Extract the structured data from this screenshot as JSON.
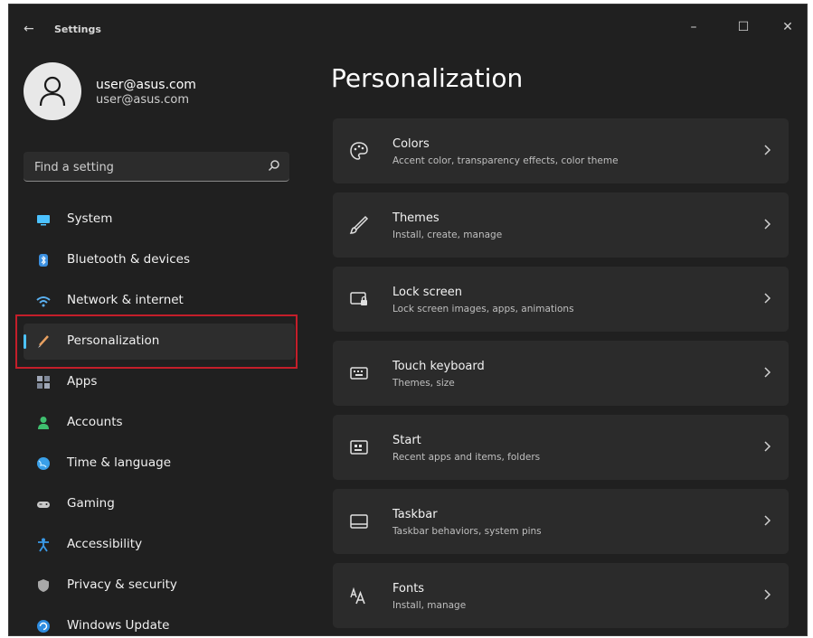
{
  "window": {
    "title": "Settings",
    "back_glyph": "←",
    "controls": {
      "minimize": "–",
      "maximize": "☐",
      "close": "✕"
    }
  },
  "profile": {
    "name": "user@asus.com",
    "email": "user@asus.com",
    "avatar_icon": "person-icon"
  },
  "search": {
    "placeholder": "Find a setting",
    "icon": "search-icon"
  },
  "sidebar": {
    "items": [
      {
        "label": "System",
        "icon": "monitor-icon",
        "color": "#4cc2ff"
      },
      {
        "label": "Bluetooth & devices",
        "icon": "bluetooth-icon",
        "color": "#3a8fe0"
      },
      {
        "label": "Network & internet",
        "icon": "wifi-icon",
        "color": "#5ab0f0"
      },
      {
        "label": "Personalization",
        "icon": "brush-icon",
        "color": "#e8a060",
        "active": true
      },
      {
        "label": "Apps",
        "icon": "apps-icon",
        "color": "#a0a8b8"
      },
      {
        "label": "Accounts",
        "icon": "person-icon",
        "color": "#3fbf6f"
      },
      {
        "label": "Time & language",
        "icon": "globe-icon",
        "color": "#3aa0e8"
      },
      {
        "label": "Gaming",
        "icon": "gamepad-icon",
        "color": "#c8c8c8"
      },
      {
        "label": "Accessibility",
        "icon": "accessibility-icon",
        "color": "#3a9ae8"
      },
      {
        "label": "Privacy & security",
        "icon": "shield-icon",
        "color": "#a8a8a8"
      },
      {
        "label": "Windows Update",
        "icon": "update-icon",
        "color": "#2e8ce0"
      }
    ]
  },
  "main": {
    "title": "Personalization",
    "cards": [
      {
        "title": "Colors",
        "subtitle": "Accent color, transparency effects, color theme",
        "icon": "palette-icon"
      },
      {
        "title": "Themes",
        "subtitle": "Install, create, manage",
        "icon": "brush-icon"
      },
      {
        "title": "Lock screen",
        "subtitle": "Lock screen images, apps, animations",
        "icon": "lock-screen-icon"
      },
      {
        "title": "Touch keyboard",
        "subtitle": "Themes, size",
        "icon": "keyboard-icon"
      },
      {
        "title": "Start",
        "subtitle": "Recent apps and items, folders",
        "icon": "start-icon"
      },
      {
        "title": "Taskbar",
        "subtitle": "Taskbar behaviors, system pins",
        "icon": "taskbar-icon"
      },
      {
        "title": "Fonts",
        "subtitle": "Install, manage",
        "icon": "fonts-icon"
      }
    ]
  },
  "colors": {
    "window_bg": "#202020",
    "card_bg": "#2b2b2b",
    "accent": "#4cc2ff",
    "highlight_box": "#c41e2a"
  }
}
